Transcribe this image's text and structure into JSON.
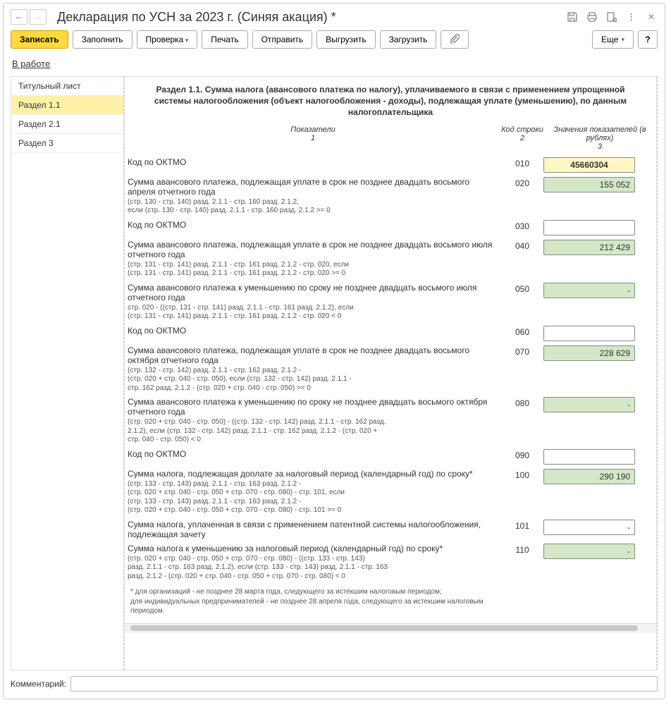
{
  "header": {
    "title": "Декларация по УСН за 2023 г. (Синяя акация) *"
  },
  "toolbar": {
    "record": "Записать",
    "fill": "Заполнить",
    "check": "Проверка",
    "print": "Печать",
    "send": "Отправить",
    "upload": "Выгрузить",
    "download": "Загрузить",
    "more": "Еще",
    "help": "?"
  },
  "status": "В работе",
  "sidebar": {
    "items": [
      {
        "label": "Титульный лист",
        "active": false
      },
      {
        "label": "Раздел 1.1",
        "active": true
      },
      {
        "label": "Раздел 2.1",
        "active": false
      },
      {
        "label": "Раздел 3",
        "active": false
      }
    ]
  },
  "section": {
    "title": "Раздел 1.1. Сумма налога (авансового платежа по налогу), уплачиваемого в связи с применением упрощенной системы налогообложения (объект налогообложения - доходы), подлежащая уплате (уменьшению), по данным налогоплательщика",
    "cols": {
      "c1a": "Показатели",
      "c1b": "1",
      "c2a": "Код строки",
      "c2b": "2",
      "c3a": "Значения показателей (в рублях)",
      "c3b": "3"
    }
  },
  "rows": [
    {
      "code": "010",
      "label": "Код по ОКТМО",
      "formula": "",
      "value": "45660304",
      "style": "highlight"
    },
    {
      "code": "020",
      "label": "Сумма авансового платежа, подлежащая уплате в срок не позднее двадцать восьмого апреля отчетного года",
      "formula": "(стр. 130 - стр. 140) разд. 2.1.1 - стр. 160 разд. 2.1.2,\nесли (стр. 130 - стр. 140) разд. 2.1.1 - стр. 160 разд. 2.1.2 >= 0",
      "value": "155 052",
      "style": "ro"
    },
    {
      "code": "030",
      "label": "Код по ОКТМО",
      "formula": "",
      "value": "",
      "style": "plain"
    },
    {
      "code": "040",
      "label": "Сумма авансового платежа, подлежащая уплате в срок не позднее двадцать восьмого июля отчетного года",
      "formula": "(стр. 131 - стр. 141) разд. 2.1.1 - стр. 161 разд. 2.1.2 - стр. 020, если\n(стр. 131 - стр. 141) разд. 2.1.1 - стр. 161 разд. 2.1.2 - стр. 020 >= 0",
      "value": "212 429",
      "style": "ro"
    },
    {
      "code": "050",
      "label": "Сумма авансового платежа к уменьшению по сроку не позднее двадцать восьмого июля отчетного года",
      "formula": "стр. 020 - ((стр. 131 - стр. 141) разд. 2.1.1 - стр. 161 разд. 2.1.2), если\n(стр. 131 - стр. 141) разд. 2.1.1 - стр. 161 разд. 2.1.2 - стр. 020 < 0",
      "value": "-",
      "style": "ro"
    },
    {
      "code": "060",
      "label": "Код по ОКТМО",
      "formula": "",
      "value": "",
      "style": "plain"
    },
    {
      "code": "070",
      "label": "Сумма авансового платежа, подлежащая уплате в срок не позднее двадцать восьмого октября отчетного года",
      "formula": "(стр. 132 - стр. 142) разд. 2.1.1 - стр. 162 разд. 2.1.2 -\n(стр. 020 + стр. 040 - стр. 050), если (стр. 132 - стр. 142) разд. 2.1.1 -\nстр. 162 разд. 2.1.2 - (стр. 020 + стр. 040 - стр. 050) >= 0",
      "value": "228 629",
      "style": "ro"
    },
    {
      "code": "080",
      "label": "Сумма авансового платежа к уменьшению по сроку не позднее двадцать восьмого октября отчетного года",
      "formula": "(стр. 020 + стр. 040 - стр. 050) - ((стр. 132 - стр. 142) разд. 2.1.1 - стр. 162 разд.\n2.1.2), если (стр. 132 - стр. 142) разд. 2.1.1 - стр. 162 разд. 2.1.2 - (стр. 020 +\nстр. 040 - стр. 050) < 0",
      "value": "-",
      "style": "ro"
    },
    {
      "code": "090",
      "label": "Код по ОКТМО",
      "formula": "",
      "value": "",
      "style": "plain"
    },
    {
      "code": "100",
      "label": "Сумма налога, подлежащая доплате за налоговый период (календарный год) по сроку*",
      "formula": "(стр. 133 - стр. 143) разд. 2.1.1 - стр. 163 разд. 2.1.2 -\n(стр. 020 + стр. 040 - стр. 050 + стр. 070 - стр. 080) - стр. 101, если\n(стр. 133 - стр. 143) разд. 2.1.1 - стр. 163 разд. 2.1.2 -\n(стр. 020 + стр. 040 - стр. 050 + стр. 070 - стр. 080) - стр. 101 >= 0",
      "value": "290 190",
      "style": "ro"
    },
    {
      "code": "101",
      "label": "Сумма налога, уплаченная в связи с применением патентной системы налогообложения, подлежащая зачету",
      "formula": "",
      "value": "-",
      "style": "ro-right"
    },
    {
      "code": "110",
      "label": "Сумма налога к уменьшению за налоговый период (календарный год) по сроку*",
      "formula": "(стр. 020 + стр. 040 - стр. 050 + стр. 070 - стр. 080) - ((стр. 133 - стр. 143)\nразд. 2.1.1 - стр. 163 разд. 2.1.2), если (стр. 133 - стр. 143) разд. 2.1.1 - стр. 163\nразд. 2.1.2 - (стр. 020 + стр. 040 - стр. 050 + стр. 070 - стр. 080) < 0",
      "value": "-",
      "style": "ro"
    }
  ],
  "footnote": "* для организаций - не позднее 28 марта года, следующего за истекшим налоговым периодом;\n  для индивидуальных предпринимателей - не позднее 28 апреля года, следующего за истекшим налоговым\n  периодом.",
  "comment": {
    "label": "Комментарий:",
    "value": ""
  }
}
